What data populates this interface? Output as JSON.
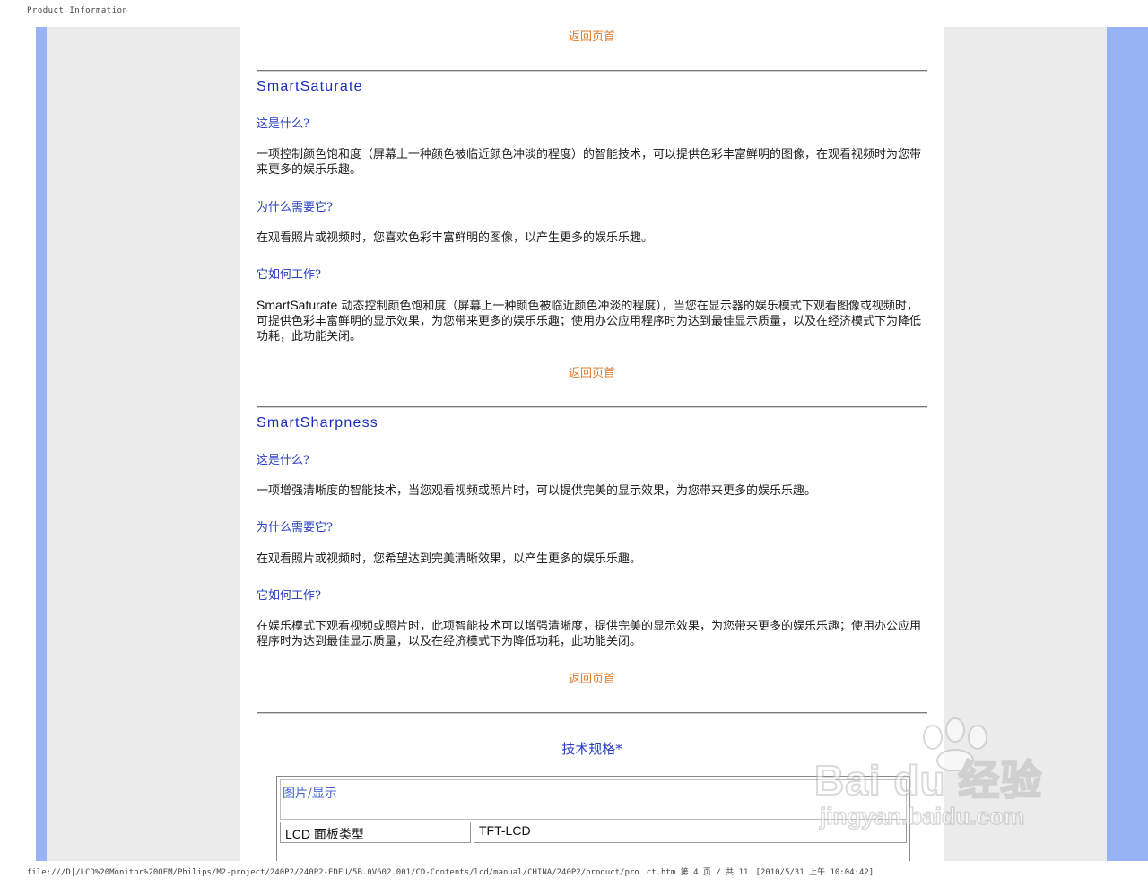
{
  "header": {
    "title": "Product Information"
  },
  "return_link": "返回页首",
  "sections": [
    {
      "title": "SmartSaturate",
      "q1": "这是什么?",
      "a1": "一项控制颜色饱和度（屏幕上一种颜色被临近颜色冲淡的程度）的智能技术，可以提供色彩丰富鲜明的图像，在观看视频时为您带来更多的娱乐乐趣。",
      "q2": "为什么需要它?",
      "a2": "在观看照片或视频时，您喜欢色彩丰富鲜明的图像，以产生更多的娱乐乐趣。",
      "q3": "它如何工作?",
      "a3_prefix": "SmartSaturate",
      "a3": " 动态控制颜色饱和度（屏幕上一种颜色被临近颜色冲淡的程度），当您在显示器的娱乐模式下观看图像或视频时，可提供色彩丰富鲜明的显示效果，为您带来更多的娱乐乐趣；使用办公应用程序时为达到最佳显示质量，以及在经济模式下为降低功耗，此功能关闭。"
    },
    {
      "title": "SmartSharpness",
      "q1": "这是什么?",
      "a1": "一项增强清晰度的智能技术，当您观看视频或照片时，可以提供完美的显示效果，为您带来更多的娱乐乐趣。",
      "q2": "为什么需要它?",
      "a2": "在观看照片或视频时，您希望达到完美清晰效果，以产生更多的娱乐乐趣。",
      "q3": "它如何工作?",
      "a3": "在娱乐模式下观看视频或照片时，此项智能技术可以增强清晰度，提供完美的显示效果，为您带来更多的娱乐乐趣；使用办公应用程序时为达到最佳显示质量，以及在经济模式下为降低功耗，此功能关闭。"
    }
  ],
  "specs": {
    "title": "技术规格*",
    "group": "图片/显示",
    "row_label": "LCD 面板类型",
    "row_value": "TFT-LCD"
  },
  "footer": {
    "path": "file:///D|/LCD%20Monitor%20OEM/Philips/M2-project/240P2/240P2-EDFU/5B.0V602.001/CD-Contents/lcd/manual/CHINA/240P2/product/pro",
    "page": "ct.htm 第 4 页 / 共 11",
    "timestamp": "[2010/5/31 上午 10:04:42]"
  },
  "watermark": {
    "logo": "Bai du 经验",
    "url": "jingyan.baidu.com"
  },
  "colors": {
    "link": "#e07a2a",
    "heading": "#1a2bbf",
    "side_blue": "#97b3f5",
    "side_gray": "#ebebeb"
  }
}
